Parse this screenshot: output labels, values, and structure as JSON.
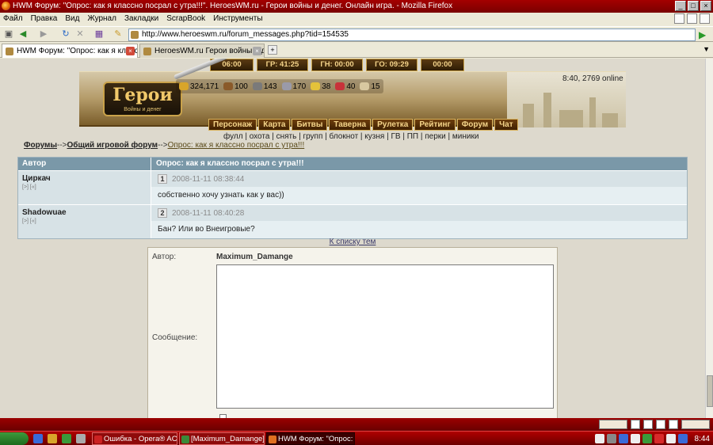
{
  "window": {
    "title": "HWM Форум: \"Опрос: как я классно посрал с утра!!!\". HeroesWM.ru - Герои войны и денег. Онлайн игра. - Mozilla Firefox"
  },
  "menu": [
    "Файл",
    "Правка",
    "Вид",
    "Журнал",
    "Закладки",
    "ScrapBook",
    "Инструменты"
  ],
  "url": "http://www.heroeswm.ru/forum_messages.php?tid=154535",
  "tabs": [
    {
      "label": "HWM Форум: \"Опрос: как я класс...",
      "active": true
    },
    {
      "label": "HeroesWM.ru Герои войны и денег. ...",
      "active": false
    }
  ],
  "game": {
    "timers": [
      "06:00",
      "ГР: 41:25",
      "ГН: 00:00",
      "ГО: 09:29",
      "00:00"
    ],
    "logo": "Герои",
    "logo_sub": "Войны и денег",
    "resources": [
      {
        "icon": "gold-icon",
        "value": "324,171",
        "color": "#d8a52a"
      },
      {
        "icon": "wood-icon",
        "value": "100",
        "color": "#8a5a2a"
      },
      {
        "icon": "ore-icon",
        "value": "143",
        "color": "#7a7a7a"
      },
      {
        "icon": "mercury-icon",
        "value": "170",
        "color": "#9a9aa8"
      },
      {
        "icon": "sulfur-icon",
        "value": "38",
        "color": "#e4c23a"
      },
      {
        "icon": "crystal-icon",
        "value": "40",
        "color": "#c8323a"
      },
      {
        "icon": "gem-icon",
        "value": "15",
        "color": "#d8c8a0"
      }
    ],
    "online": "8:40, 2769 online",
    "nav": [
      "Персонаж",
      "Карта",
      "Битвы",
      "Таверна",
      "Рулетка",
      "Рейтинг",
      "Форум",
      "Чат"
    ],
    "submenu": "фулл | охота | снять | групп | блокнот | кузня | ГВ | ПП | перки | миники"
  },
  "breadcrumb": {
    "forums": "Форумы",
    "arrow1": "-->",
    "section": "Общий игровой форум",
    "arrow2": "-->",
    "topic": "Опрос: как я классно посрал с утра!!!"
  },
  "forum": {
    "col_author": "Автор",
    "col_topic": "Опрос: как я классно посрал с утра!!!",
    "posts": [
      {
        "num": "1",
        "author": "Циркач",
        "links": "[>] [«]",
        "date": "2008-11-11 08:38:44",
        "text": "собственно хочу узнать как у вас))"
      },
      {
        "num": "2",
        "author": "Shadowuae",
        "links": "[>] [«]",
        "date": "2008-11-11 08:40:28",
        "text": "Бан? Или во Внеигровые?"
      }
    ],
    "back_link": "К списку тем"
  },
  "reply": {
    "author_label": "Автор:",
    "author_value": "Maximum_Damange",
    "message_label": "Сообщение:"
  },
  "taskbar": {
    "tasks": [
      {
        "label": "Ошибка - Opera® AC 3...",
        "active": false,
        "color": "#c22"
      },
      {
        "label": "[Maximum_Damange] - ...",
        "active": false,
        "color": "#3a8a3a"
      },
      {
        "label": "HWM Форум: \"Опрос: к...",
        "active": true,
        "color": "#e07020"
      }
    ],
    "clock": "8:44"
  }
}
